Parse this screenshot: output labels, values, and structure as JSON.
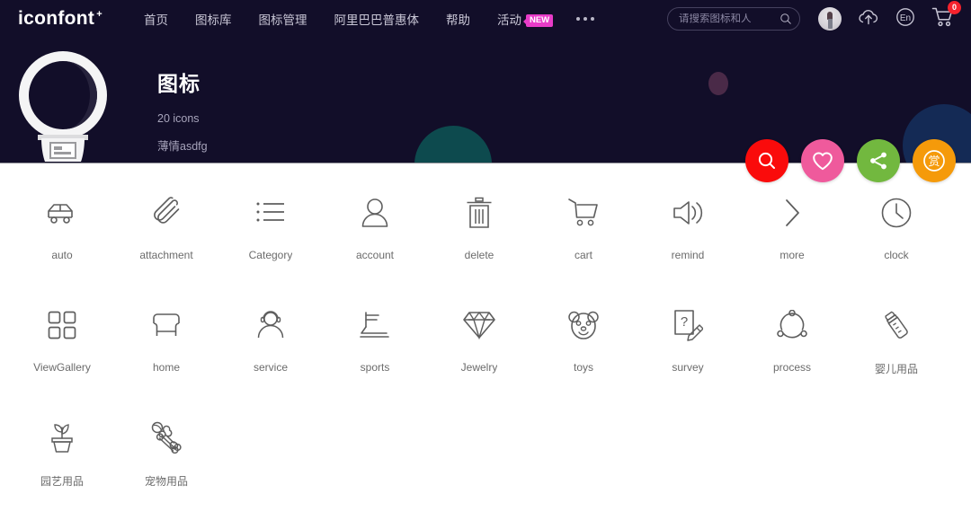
{
  "nav": {
    "logo": "iconfont",
    "logo_mark": "+",
    "links": [
      {
        "label": "首页",
        "name": "home"
      },
      {
        "label": "图标库",
        "name": "icon-library"
      },
      {
        "label": "图标管理",
        "name": "icon-management"
      },
      {
        "label": "阿里巴巴普惠体",
        "name": "alibaba-font"
      },
      {
        "label": "帮助",
        "name": "help"
      },
      {
        "label": "活动",
        "name": "activity",
        "badge": "NEW"
      }
    ],
    "more_menu": "···",
    "search": {
      "placeholder": "请搜索图标和人",
      "value": ""
    },
    "language": "En",
    "cart_count": "0"
  },
  "hero": {
    "title": "图标",
    "count": "20 icons",
    "author": "薄情asdfg",
    "actions": [
      {
        "name": "search",
        "label": "搜索",
        "color": "#fa0b0b",
        "glyph": "search-icon"
      },
      {
        "name": "favorite",
        "label": "收藏",
        "color": "#ef5a9c",
        "glyph": "heart-icon"
      },
      {
        "name": "share",
        "label": "分享",
        "color": "#72b83f",
        "glyph": "share-icon"
      },
      {
        "name": "reward",
        "label": "赏",
        "color": "#f59a0a",
        "glyph": "reward-icon"
      }
    ]
  },
  "icons": [
    {
      "label": "auto",
      "glyph": "car-icon"
    },
    {
      "label": "attachment",
      "glyph": "paperclip-icon"
    },
    {
      "label": "Category",
      "glyph": "list-icon"
    },
    {
      "label": "account",
      "glyph": "person-icon"
    },
    {
      "label": "delete",
      "glyph": "trash-icon"
    },
    {
      "label": "cart",
      "glyph": "cart-icon"
    },
    {
      "label": "remind",
      "glyph": "speaker-icon"
    },
    {
      "label": "more",
      "glyph": "chevron-right-icon"
    },
    {
      "label": "clock",
      "glyph": "clock-icon"
    },
    {
      "label": "ViewGallery",
      "glyph": "grid-icon"
    },
    {
      "label": "home",
      "glyph": "armchair-icon"
    },
    {
      "label": "service",
      "glyph": "headset-person-icon"
    },
    {
      "label": "sports",
      "glyph": "treadmill-icon"
    },
    {
      "label": "Jewelry",
      "glyph": "diamond-icon"
    },
    {
      "label": "toys",
      "glyph": "bear-icon"
    },
    {
      "label": "survey",
      "glyph": "question-paper-pencil-icon"
    },
    {
      "label": "process",
      "glyph": "process-nodes-icon"
    },
    {
      "label": "婴儿用品",
      "glyph": "baby-bottle-icon"
    },
    {
      "label": "园艺用品",
      "glyph": "potted-plant-icon"
    },
    {
      "label": "宠物用品",
      "glyph": "bone-ball-icon"
    }
  ]
}
